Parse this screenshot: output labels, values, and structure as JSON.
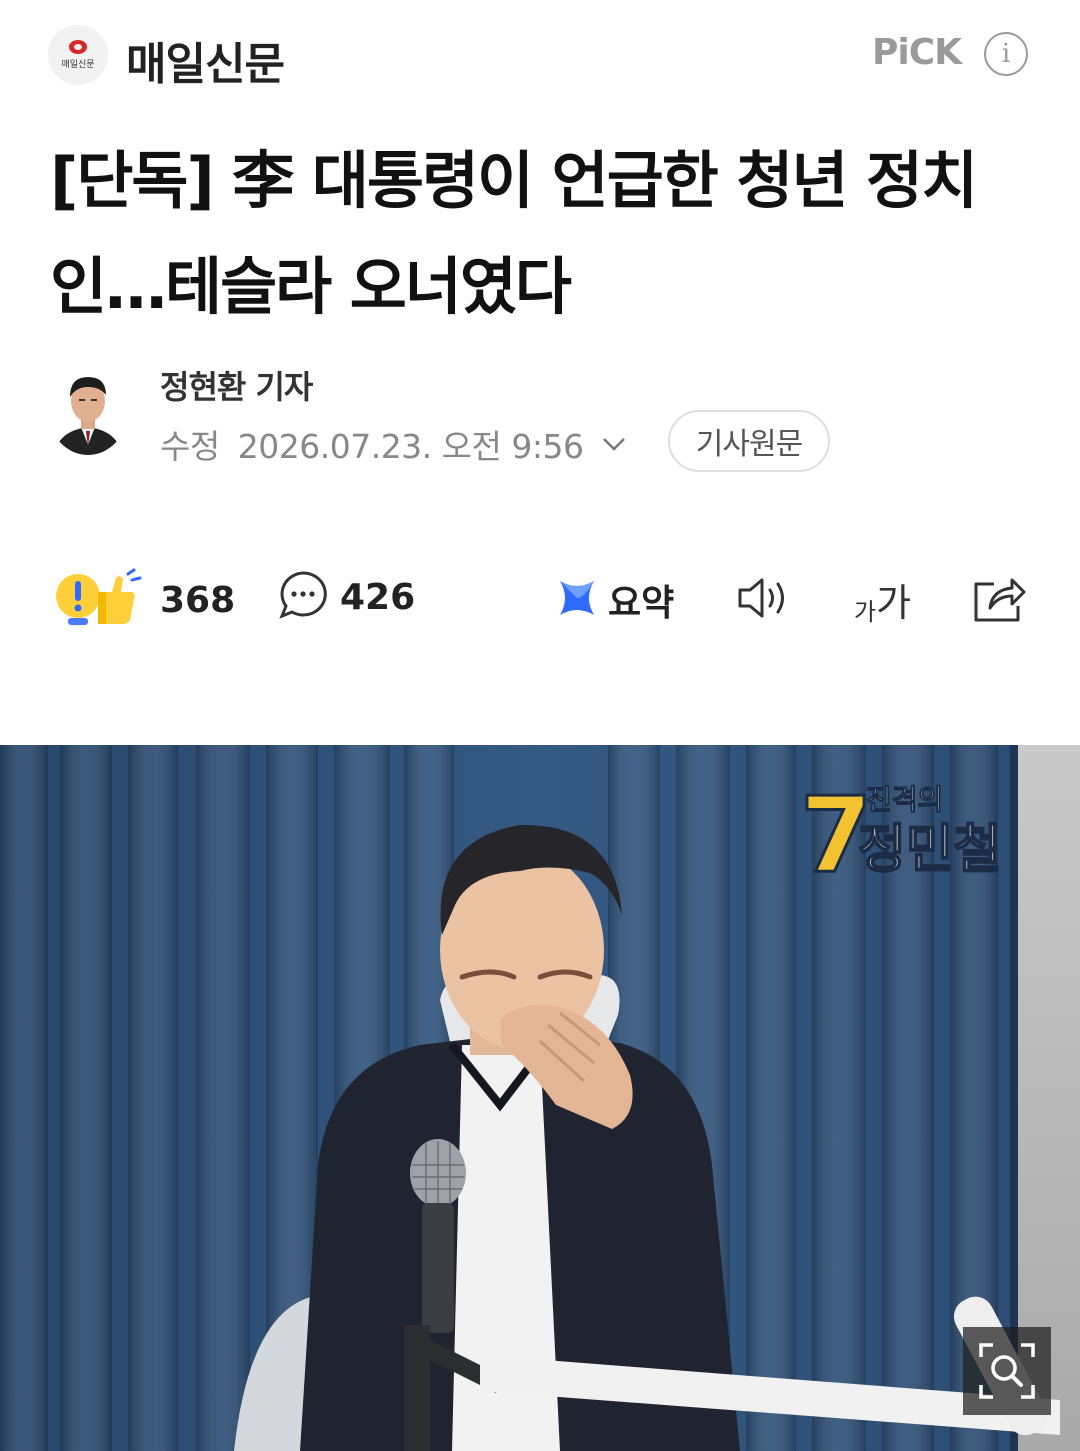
{
  "press": {
    "logo_text": "매일신문",
    "name": "매일신문",
    "pick_label": "PiCK",
    "info_icon": "info-icon"
  },
  "article": {
    "headline": "[단독] 李 대통령이 언급한 청년 정치인…테슬라 오너였다"
  },
  "byline": {
    "reporter": "정현환 기자",
    "edit_label": "수정",
    "timestamp": "2026.07.23. 오전 9:56",
    "original_button": "기사원문"
  },
  "toolbar": {
    "reaction_count": "368",
    "comment_count": "426",
    "summary_label": "요약",
    "font_label_small": "가",
    "font_label_large": "가",
    "icons": [
      "reaction-icon",
      "comment-icon",
      "summary-icon",
      "speaker-icon",
      "font-size-icon",
      "share-icon"
    ]
  },
  "photo": {
    "overlay_number": "7",
    "overlay_small": "진격의",
    "overlay_name": "정민철",
    "zoom_icon": "zoom-icon"
  },
  "colors": {
    "brand_red": "#d6282b",
    "curtain_blue": "#2e4f78",
    "text_dark": "#111111",
    "text_gray": "#888888",
    "summary_blue": "#2f6bff"
  }
}
